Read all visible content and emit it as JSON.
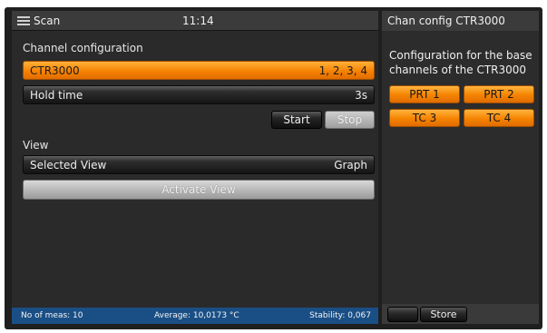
{
  "header": {
    "app_title": "Scan",
    "time": "11:14",
    "menu_icon": "hamburger-menu-icon"
  },
  "channel_config": {
    "heading": "Channel configuration",
    "device": {
      "label": "CTR3000",
      "channels": "1, 2, 3, 4"
    },
    "hold_time": {
      "label": "Hold time",
      "value": "3s"
    },
    "start_label": "Start",
    "stop_label": "Stop"
  },
  "view": {
    "heading": "View",
    "selected_view": {
      "label": "Selected View",
      "value": "Graph"
    },
    "activate_label": "Activate View"
  },
  "status": {
    "meas_count": "No of meas: 10",
    "average": "Average: 10,0173 °C",
    "stability": "Stability: 0,067"
  },
  "side_panel": {
    "title": "Chan config CTR3000",
    "description": "Configuration for the base channels of the CTR3000",
    "channels": [
      "PRT 1",
      "PRT 2",
      "TC 3",
      "TC 4"
    ],
    "store_label": "Store"
  },
  "colors": {
    "accent_orange": "#f58300",
    "status_blue": "#1a4f86"
  }
}
